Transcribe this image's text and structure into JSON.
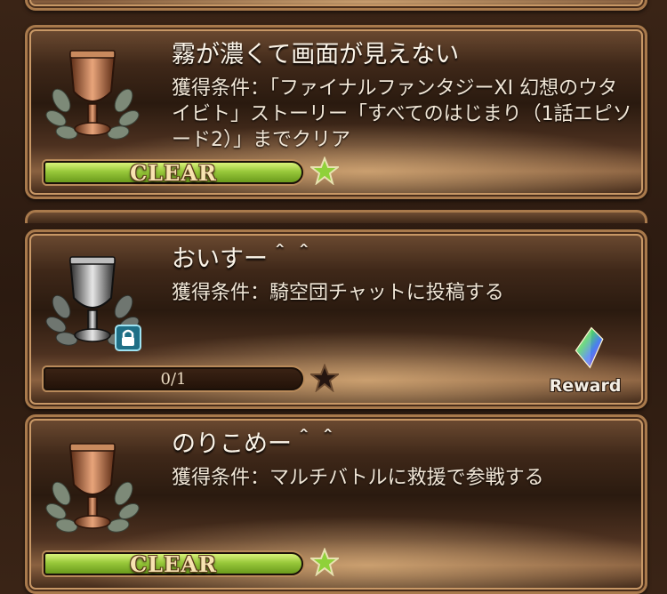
{
  "achievements": [
    {
      "title": "霧が濃くて画面が見えない",
      "condition": "獲得条件：「ファイナルファンタジーXI 幻想のウタイビト」ストーリー「すべてのはじまり（1話エピソード2）」までクリア",
      "status": "CLEAR",
      "trophy": "bronze-trophy-icon",
      "star": "green-star-icon"
    },
    {
      "title": "おいすー＾＾",
      "condition": "獲得条件：騎空団チャットに投稿する",
      "progress_text": "0/1",
      "progress": 0,
      "locked": true,
      "trophy": "silver-trophy-icon",
      "star": "dark-star-icon",
      "reward_label": "Reward"
    },
    {
      "title": "のりこめー＾＾",
      "condition": "獲得条件：マルチバトルに救援で参戦する",
      "status": "CLEAR",
      "trophy": "bronze-trophy-icon",
      "star": "green-star-icon"
    }
  ],
  "colors": {
    "clear_bar": "#98c83a",
    "frame": "#a97a4c",
    "title_text": "#fbf4e8"
  }
}
